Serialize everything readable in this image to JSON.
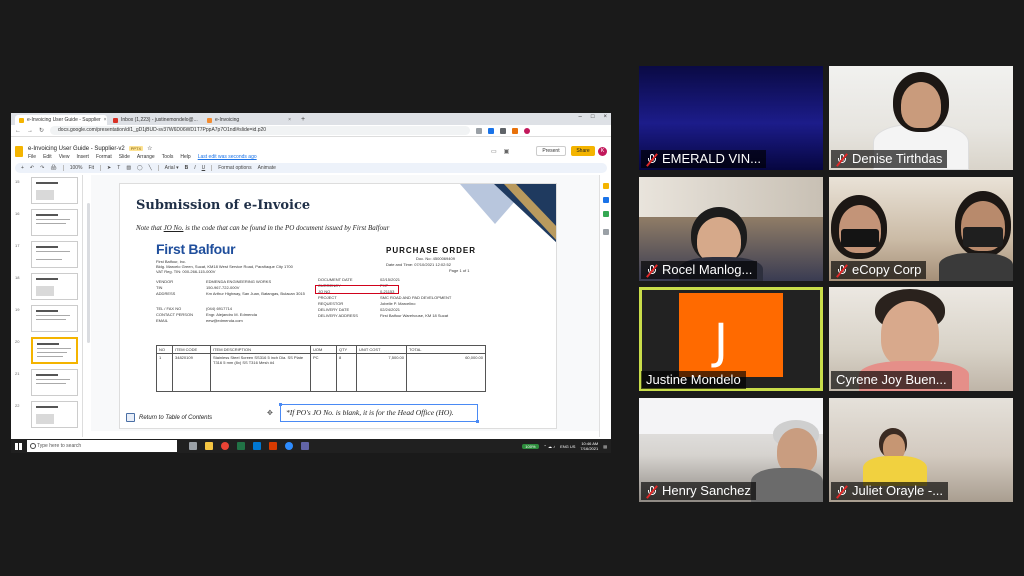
{
  "browser": {
    "tabs": [
      {
        "label": "e-Invoicing User Guide - Supplier",
        "favicon_color": "#f4b400",
        "active": true
      },
      {
        "label": "Inbox (1,223) - justinemondelo@...",
        "favicon_color": "#d93025",
        "active": false
      },
      {
        "label": "e-Invoicing",
        "favicon_color": "#f28b30",
        "active": false
      }
    ],
    "new_tab": "+",
    "url": "docs.google.com/presentation/d/1_gD1jBUD-sv37W6D06WD1T7PppA7p7O1ndl#slide=id.p20"
  },
  "slides_app": {
    "doc_title": "e-Invoicing User Guide - Supplier-v2",
    "badge": "PPTX",
    "menus": [
      "File",
      "Edit",
      "View",
      "Insert",
      "Format",
      "Slide",
      "Arrange",
      "Tools",
      "Help"
    ],
    "last_edit": "Last edit was seconds ago",
    "present_label": "Present",
    "share_label": "Share",
    "account_initial": "K",
    "toolbar_items": [
      "+",
      "↶",
      "↷",
      "🖨",
      "100%",
      "Fit",
      "Format options",
      "Animate"
    ],
    "thumb_numbers": [
      "15",
      "16",
      "17",
      "18",
      "19",
      "20",
      "21",
      "22"
    ]
  },
  "slide": {
    "title": "Submission of e-Invoice",
    "note_prefix": "Note that ",
    "note_jo": "JO No.",
    "note_suffix": " is the code that can be found in the PO document issued by First Balfour",
    "return_link": "Return to Table of Contents",
    "note_box": "*If PO's JO No. is blank, it is for the Head Office (HO)."
  },
  "po": {
    "logo": "First Balfour",
    "company": "First Balfour, Inc.",
    "address": "Bldg. Marcelo Green, Sucat, KM18 West Service Road, Parañaque City 1700",
    "vat": "VAT Reg. TIN: 000-266-115-000V",
    "title": "PURCHASE   ORDER",
    "doc_no": "Doc. No: 4500069409",
    "date_time": "Date and Time: 07/10/2021 12:02:52",
    "page": "Page 1 of 1",
    "left_rows": [
      {
        "label": "VENDOR",
        "value": "EDMENDA ENGINEERING WORKS"
      },
      {
        "label": "TIN",
        "value": "150-967-722-000V"
      },
      {
        "label": "ADDRESS",
        "value": "Km Arthur Highway, San Juan, Batangas, Bulacan 3015"
      },
      {
        "label": "",
        "value": ""
      },
      {
        "label": "TEL / FAX NO",
        "value": "(044) 6917714"
      },
      {
        "label": "CONTACT PERSON",
        "value": "Engr. Alejandro M. Edmenda"
      },
      {
        "label": "EMAIL",
        "value": "eew@edmenda.com"
      }
    ],
    "right_rows": [
      {
        "label": "DOCUMENT DATE",
        "value": "02/15/2021"
      },
      {
        "label": "CURRENCY",
        "value": "PHP"
      },
      {
        "label": "JO NO",
        "value": "0-21153"
      },
      {
        "label": "PROJECT",
        "value": "SMC ROAD AND PAD DEVELOPMENT"
      },
      {
        "label": "REQUESTOR",
        "value": "Jobelle P. Marcelino"
      },
      {
        "label": "DELIVERY DATE",
        "value": "02/24/2021"
      },
      {
        "label": "DELIVERY ADDRESS",
        "value": "First Balfour Warehouse, KM 18 Sucat"
      }
    ],
    "table": {
      "headers": [
        "NO",
        "ITEM CODE",
        "ITEM DESCRIPTION",
        "UOM",
        "QTY",
        "UNIT COST",
        "TOTAL"
      ],
      "rows": [
        [
          "1",
          "34820109",
          "Stainless Steel Screen SS316 5 inch Dia. SS Plate T316 5 mm (8x) SS T316 Mesh #4",
          "PC",
          "8",
          "7,500.00",
          "60,000.00"
        ]
      ]
    }
  },
  "taskbar": {
    "search_placeholder": "Type here to search",
    "zoom_pill": "100%",
    "lang": "ENG US",
    "time": "10:46 AM",
    "date": "7/16/2021"
  },
  "participants": [
    {
      "name": "EMERALD VIN...",
      "muted": true
    },
    {
      "name": "Denise Tirthdas",
      "muted": true
    },
    {
      "name": "Rocel Manlog...",
      "muted": true
    },
    {
      "name": "eCopy Corp",
      "muted": true
    },
    {
      "name": "Justine Mondelo",
      "muted": false,
      "initial": "J",
      "avatar_color": "#ff6a00",
      "active_speaker": true
    },
    {
      "name": "Cyrene Joy Buen...",
      "muted": false
    },
    {
      "name": "Henry Sanchez",
      "muted": true
    },
    {
      "name": "Juliet Orayle -...",
      "muted": true
    }
  ],
  "colors": {
    "active_speaker_border": "#c9dd4a",
    "mute_red": "#e02828",
    "slides_yellow": "#f4b400",
    "jo_highlight": "#d0021b",
    "balfour_blue": "#1f4e9c"
  }
}
